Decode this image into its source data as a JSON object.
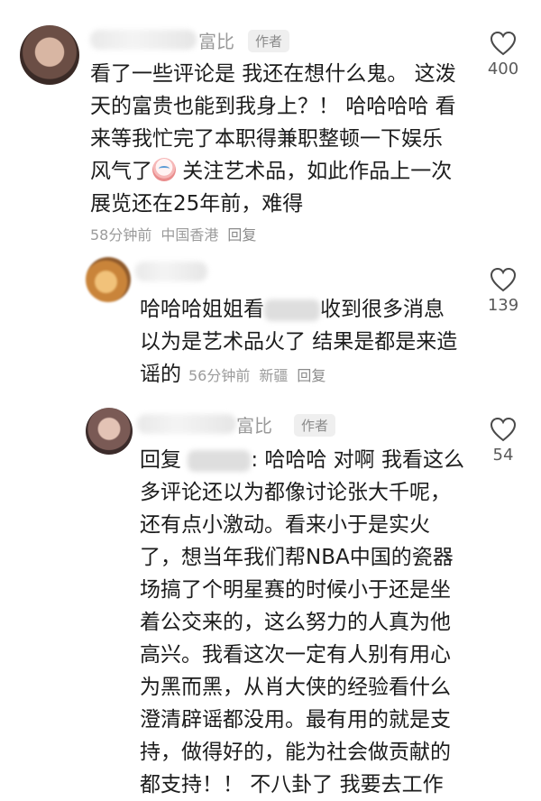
{
  "comments": [
    {
      "name_suffix": "富比",
      "author_tag": "作者",
      "lines": [
        "看了一些评论是 我还在想什么鬼。 这泼",
        "天的富贵也能到我身上？！ 哈哈哈哈 看",
        "来等我忙完了本职得兼职整顿一下娱乐",
        "风气了",
        " 关注艺术品，如此作品上一次",
        "展览还在25年前，难得"
      ],
      "time": "58分钟前",
      "location": "中国香港",
      "reply": "回复",
      "likes": "400"
    },
    {
      "lines": [
        "哈哈哈姐姐看",
        "收到很多消息",
        "以为是艺术品火了 结果是都是来造",
        "谣的"
      ],
      "time": "56分钟前",
      "location": "新疆",
      "reply": "回复",
      "likes": "139"
    },
    {
      "name_suffix": "富比",
      "author_tag": "作者",
      "reply_prefix": "回复",
      "lines": [
        ": 哈哈哈 对啊 我看这么",
        "多评论还以为都像讨论张大千呢，",
        "还有点小激动。看来小于是实火",
        "了，想当年我们帮NBA中国的瓷器",
        "场搞了个明星赛的时候小于还是坐",
        "着公交来的，这么努力的人真为他",
        "高兴。我看这次一定有人别有用心",
        "为黑而黑，从肖大侠的经验看什么",
        "澄清辟谣都没用。最有用的就是支",
        "持，做得好的，能为社会做贡献的",
        "都支持！！ 不八卦了 我要去工作"
      ],
      "likes": "54"
    }
  ]
}
